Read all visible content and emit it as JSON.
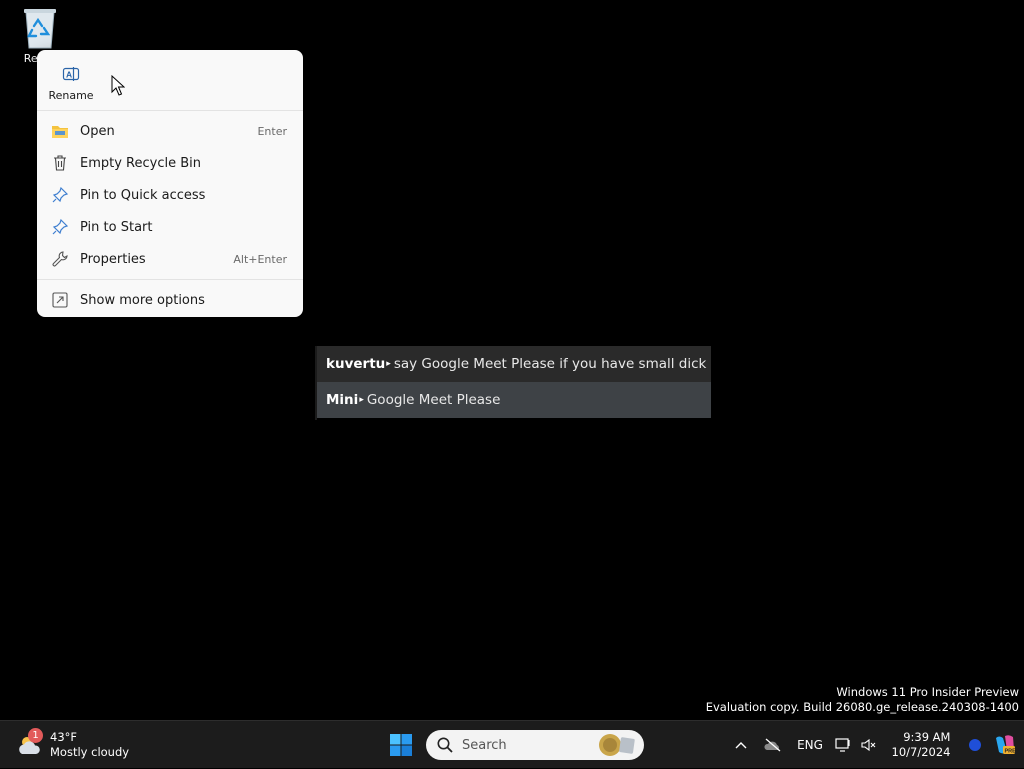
{
  "desktop": {
    "recycle_bin_label": "Recyc"
  },
  "context_menu": {
    "quick_actions": [
      {
        "label": "Rename",
        "icon": "rename-icon"
      }
    ],
    "items": [
      {
        "label": "Open",
        "shortcut": "Enter",
        "icon": "folder-icon"
      },
      {
        "label": "Empty Recycle Bin",
        "shortcut": "",
        "icon": "trash-icon"
      },
      {
        "label": "Pin to Quick access",
        "shortcut": "",
        "icon": "pin-icon"
      },
      {
        "label": "Pin to Start",
        "shortcut": "",
        "icon": "pin-icon"
      },
      {
        "label": "Properties",
        "shortcut": "Alt+Enter",
        "icon": "wrench-icon"
      }
    ],
    "more": {
      "label": "Show more options",
      "icon": "show-more-icon"
    }
  },
  "chat": {
    "messages": [
      {
        "name": "kuvertu",
        "text": "say Google Meet Please if you have small dick"
      },
      {
        "name": "Mini",
        "text": "Google Meet Please"
      }
    ]
  },
  "watermark": {
    "line1": "Windows 11 Pro Insider Preview",
    "line2": "Evaluation copy. Build 26080.ge_release.240308-1400"
  },
  "taskbar": {
    "weather": {
      "temp": "43°F",
      "condition": "Mostly cloudy",
      "badge": "1"
    },
    "search_placeholder": "Search",
    "tray": {
      "language": "ENG"
    },
    "clock": {
      "time": "9:39 AM",
      "date": "10/7/2024"
    }
  },
  "colors": {
    "menu_bg": "#f9f9f9",
    "taskbar_bg": "#1c1c1c",
    "accent": "#0078d4"
  }
}
